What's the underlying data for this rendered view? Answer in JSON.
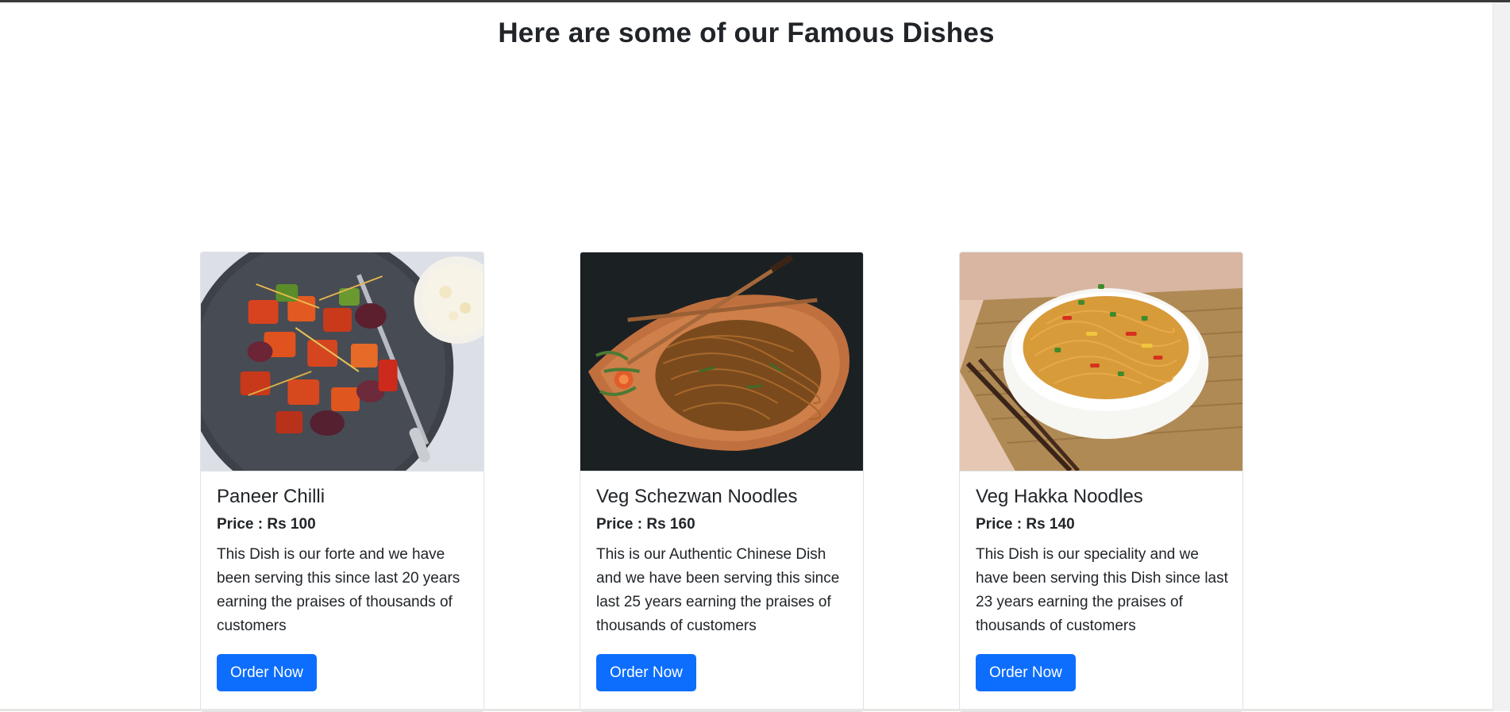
{
  "section": {
    "heading": "Here are some of our Famous Dishes"
  },
  "dishes": [
    {
      "title": "Paneer Chilli",
      "price": "Price : Rs 100",
      "description": "This Dish is our forte and we have been serving this since last 20 years earning the praises of thousands of customers",
      "button_label": "Order Now",
      "image": "paneer-chilli-photo"
    },
    {
      "title": "Veg Schezwan Noodles",
      "price": "Price : Rs 160",
      "description": "This is our Authentic Chinese Dish and we have been serving this since last 25 years earning the praises of thousands of customers",
      "button_label": "Order Now",
      "image": "schezwan-noodles-photo"
    },
    {
      "title": "Veg Hakka Noodles",
      "price": "Price : Rs 140",
      "description": "This Dish is our speciality and we have been serving this Dish since last 23 years earning the praises of thousands of customers",
      "button_label": "Order Now",
      "image": "hakka-noodles-photo"
    }
  ],
  "colors": {
    "primary_button": "#0d6efd",
    "text": "#212529",
    "card_border": "#dfe2e6"
  }
}
